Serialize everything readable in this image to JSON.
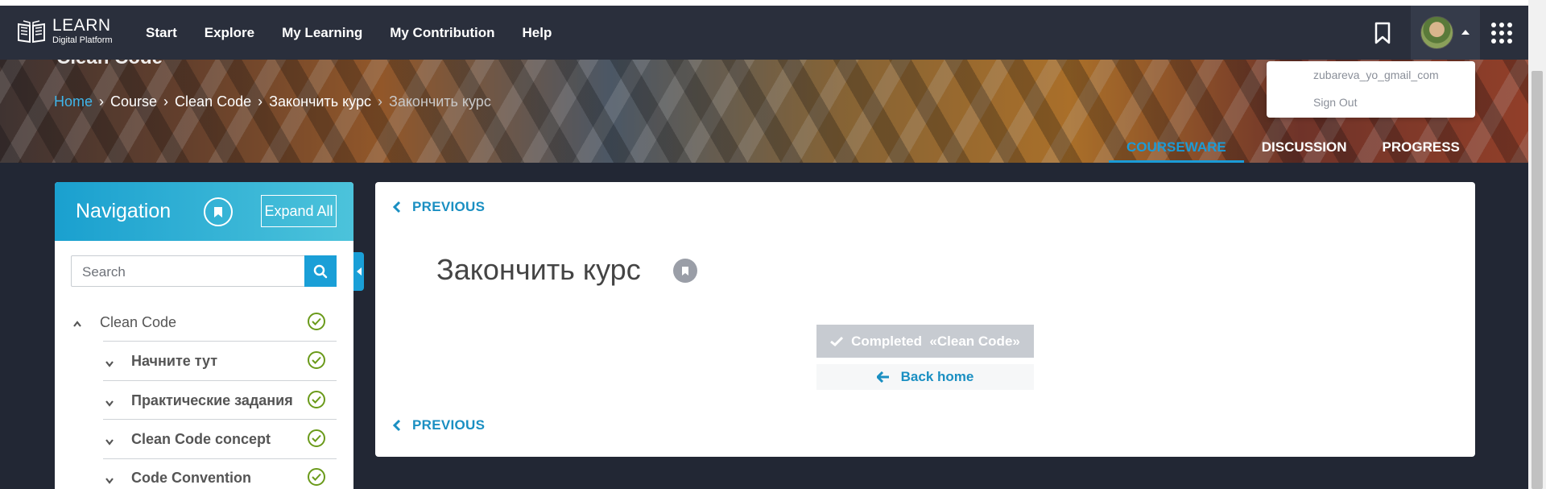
{
  "brand": {
    "name": "LEARN",
    "subtitle": "Digital Platform"
  },
  "topnav": {
    "items": [
      "Start",
      "Explore",
      "My Learning",
      "My Contribution",
      "Help"
    ]
  },
  "user_menu": {
    "email": "zubareva_yo_gmail_com",
    "signout": "Sign Out"
  },
  "course": {
    "title": "Clean Code"
  },
  "breadcrumb": {
    "home": "Home",
    "items": [
      "Course",
      "Clean Code",
      "Закончить курс"
    ],
    "current": "Закончить курс"
  },
  "tabs": [
    "COURSEWARE",
    "DISCUSSION",
    "PROGRESS"
  ],
  "sidebar": {
    "title": "Navigation",
    "expand_all": "Expand All",
    "search_placeholder": "Search",
    "items": [
      {
        "label": "Clean Code",
        "expanded": true,
        "completed": true
      },
      {
        "label": "Начните тут",
        "expanded": false,
        "completed": true
      },
      {
        "label": "Практические задания",
        "expanded": false,
        "completed": true
      },
      {
        "label": "Clean Code concept",
        "expanded": false,
        "completed": true
      },
      {
        "label": "Code Convention",
        "expanded": false,
        "completed": true
      }
    ]
  },
  "content": {
    "previous": "PREVIOUS",
    "unit_title": "Закончить курс",
    "completed": "Completed  «Clean Code»",
    "back_home": "Back home"
  },
  "colors": {
    "accent": "#1a9fd7",
    "topbar": "#2a2f3c",
    "completed_button": "#c7cbd1",
    "check": "#6a9a1a"
  },
  "icons": [
    "book-icon",
    "bookmark-icon",
    "apps-grid-icon",
    "search-icon",
    "chevron-up-icon",
    "chevron-down-icon",
    "check-circle-icon",
    "chevron-left-icon",
    "check-icon",
    "arrow-left-icon"
  ]
}
